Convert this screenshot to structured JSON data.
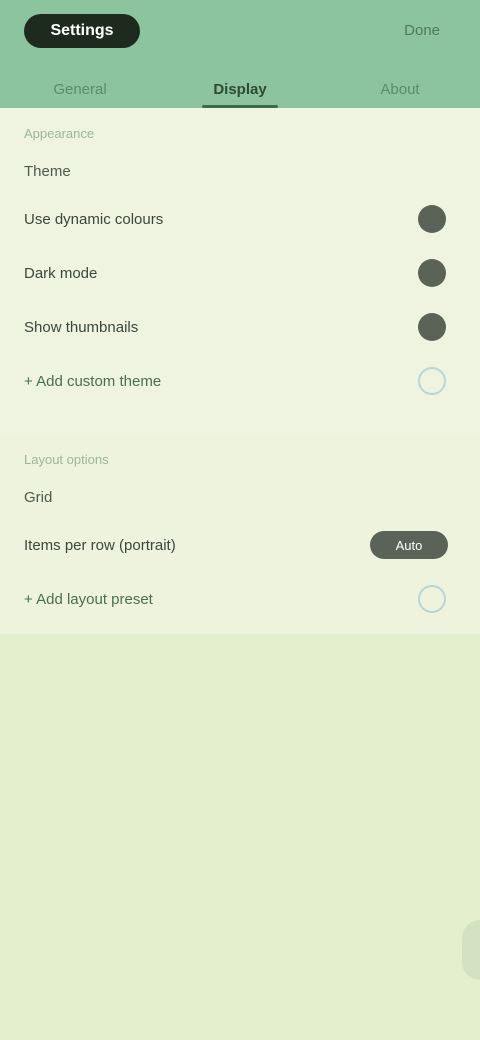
{
  "header": {
    "title": "Settings",
    "action_label": "Done",
    "tabs": [
      {
        "label": "General"
      },
      {
        "label": "Display"
      },
      {
        "label": "About"
      }
    ],
    "active_tab_index": 1
  },
  "section_a": {
    "label": "Appearance",
    "group_label": "Theme",
    "rows": [
      {
        "label": "Use dynamic colours",
        "control": "toggle",
        "state": "on"
      },
      {
        "label": "Dark mode",
        "control": "toggle",
        "state": "on"
      },
      {
        "label": "Show thumbnails",
        "control": "toggle",
        "state": "on"
      },
      {
        "label": "+ Add custom theme",
        "control": "toggle",
        "state": "off"
      }
    ]
  },
  "section_b": {
    "label": "Layout options",
    "group_label": "Grid",
    "rows": [
      {
        "label": "Items per row (portrait)",
        "control": "value",
        "value": "Auto"
      },
      {
        "label": "+ Add layout preset",
        "control": "toggle",
        "state": "off"
      }
    ]
  },
  "colors": {
    "header_bg": "#8cc4a0",
    "page_bg": "#e4efcd",
    "accent": "#3d6b4a",
    "toggle_on": "#5b6358",
    "toggle_off_ring": "#b9d5d6"
  }
}
